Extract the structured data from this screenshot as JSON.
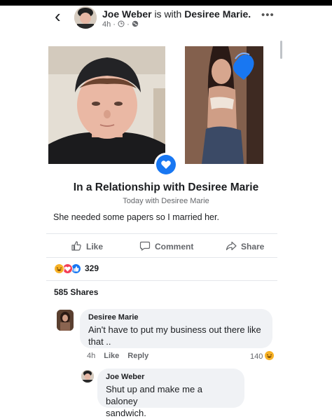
{
  "header": {
    "poster_name": "Joe Weber",
    "with_text": "is with",
    "tagged_name": "Desiree Marie.",
    "time": "4h ·",
    "icons": [
      "chevron-left-icon",
      "clock-icon",
      "globe-icon",
      "more-icon"
    ]
  },
  "life_event": {
    "title": "In a Relationship with Desiree Marie",
    "date": "Today with Desiree Marie",
    "icon": "heart-icon"
  },
  "caption": "She needed some papers so I married her.",
  "actions": {
    "like": "Like",
    "comment": "Comment",
    "share": "Share"
  },
  "reactions": {
    "count": "329",
    "types": [
      "haha",
      "love",
      "like"
    ]
  },
  "shares": "585 Shares",
  "comments": [
    {
      "name": "Desiree Marie",
      "line1": "Ain't have to put my business out there like",
      "line2": "that ..",
      "time": "4h",
      "like": "Like",
      "reply": "Reply",
      "likes": "140"
    },
    {
      "name": "Joe Weber",
      "line1": "Shut up and make me a baloney",
      "line2": "sandwich."
    }
  ],
  "colors": {
    "accent": "#1877f2",
    "reaction_haha": "#f7b125",
    "reaction_love": "#f33e58"
  }
}
